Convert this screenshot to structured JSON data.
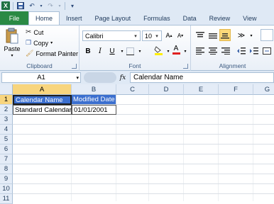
{
  "qat": {
    "logo": "X",
    "undo": "↶",
    "redo": "↷"
  },
  "tabs": [
    "File",
    "Home",
    "Insert",
    "Page Layout",
    "Formulas",
    "Data",
    "Review",
    "View"
  ],
  "clipboard": {
    "paste": "Paste",
    "cut": "Cut",
    "copy": "Copy",
    "format_painter": "Format Painter",
    "label": "Clipboard"
  },
  "font": {
    "name": "Calibri",
    "size": "10",
    "bold": "B",
    "italic": "I",
    "underline": "U",
    "label": "Font"
  },
  "alignment": {
    "label": "Alignment"
  },
  "formula_bar": {
    "name_box": "A1",
    "fx": "fx",
    "content": "Calendar Name"
  },
  "columns": [
    "A",
    "B",
    "C",
    "D",
    "E",
    "F",
    "G"
  ],
  "rows": [
    "1",
    "2",
    "3",
    "4",
    "5",
    "6",
    "7",
    "8",
    "9",
    "10",
    "11"
  ],
  "cells": {
    "A1": "Calendar Name",
    "B1": "Modified Date",
    "A2": "Standard Calendar",
    "B2": "01/01/2001"
  },
  "colors": {
    "header_fill": "#3b6fcf",
    "file_tab": "#2a8a44",
    "selected_header": "#f8d57e"
  }
}
